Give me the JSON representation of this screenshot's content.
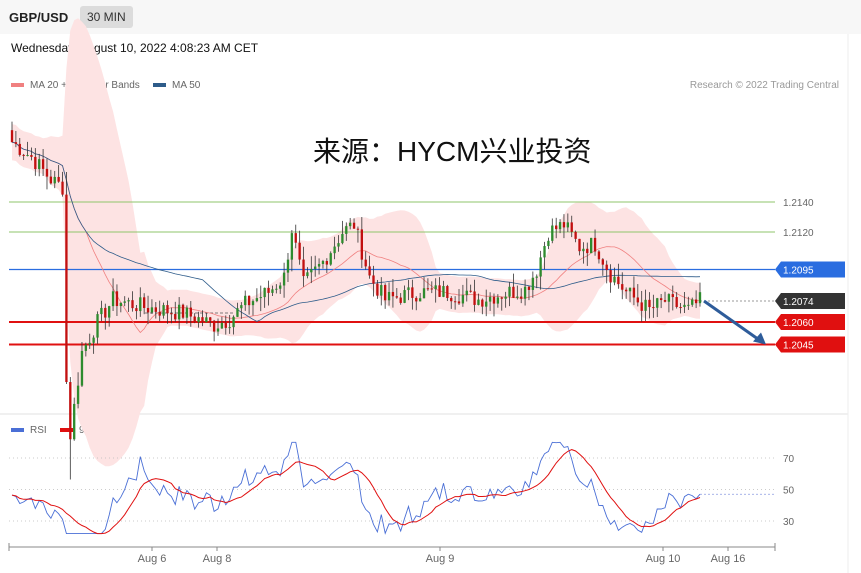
{
  "header": {
    "symbol": "GBP/USD",
    "timeframe": "30 MIN"
  },
  "timestamp": "Wednesday, August 10, 2022 4:08:23 AM CET",
  "legend": [
    {
      "label": "MA 20 + Bollinger Bands",
      "color": "#f08080"
    },
    {
      "label": "MA 50",
      "color": "#2e5c8a"
    }
  ],
  "credit": "Research © 2022 Trading Central",
  "watermark": "来源：HYCM兴业投资",
  "rsi_legend": [
    {
      "label": "RSI",
      "color": "#4a6fd6"
    },
    {
      "label": "9MA",
      "color": "#e01010"
    }
  ],
  "chart_data": [
    {
      "type": "candlestick",
      "ylim": [
        1.1945,
        1.2235
      ],
      "x_labels": [
        "Aug 6",
        "Aug 8",
        "Aug 9",
        "Aug 10",
        "Aug 16"
      ],
      "levels": [
        {
          "value": 1.214,
          "label": "1.2140",
          "color": "#8fc46b",
          "style": "thin"
        },
        {
          "value": 1.212,
          "label": "1.2120",
          "color": "#8fc46b",
          "style": "thin"
        },
        {
          "value": 1.2095,
          "label": "1.2095",
          "color": "#2a6de0",
          "style": "resistance"
        },
        {
          "value": 1.2074,
          "label": "1.2074",
          "color": "#333333",
          "style": "last-price"
        },
        {
          "value": 1.206,
          "label": "1.2060",
          "color": "#e01010",
          "style": "support"
        },
        {
          "value": 1.2045,
          "label": "1.2045",
          "color": "#e01010",
          "style": "support"
        }
      ],
      "forecast_arrow": {
        "from": 1.2074,
        "to": 1.2045,
        "color": "#2e5c9a"
      }
    },
    {
      "type": "line",
      "series": [
        {
          "name": "RSI",
          "color": "#4a6fd6"
        },
        {
          "name": "9MA",
          "color": "#e01010"
        }
      ],
      "ylim": [
        22,
        82
      ],
      "y_ticks": [
        70,
        50,
        30
      ],
      "last_rsi": 47
    }
  ]
}
